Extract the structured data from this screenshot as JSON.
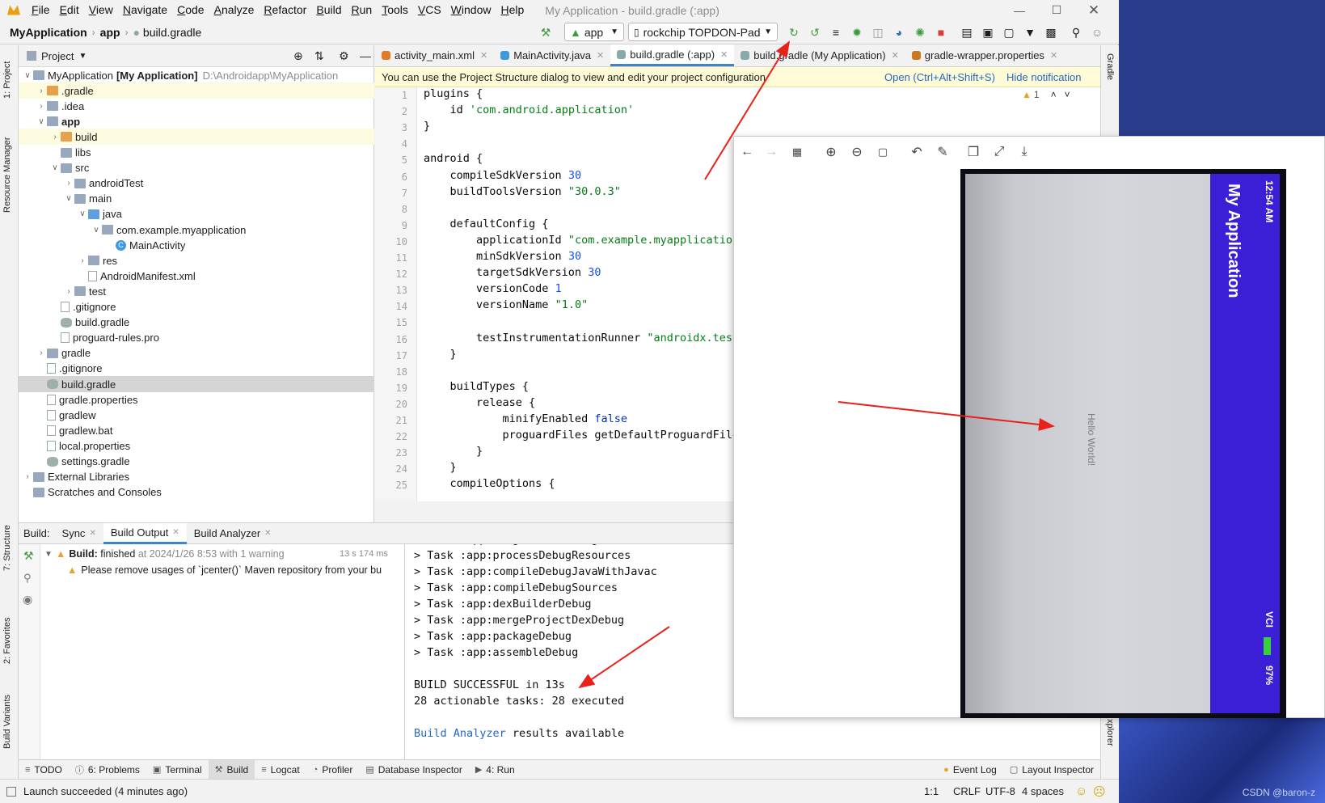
{
  "menubar": {
    "items": [
      {
        "label": "File",
        "mnemonic": "F",
        "rest": "ile"
      },
      {
        "label": "Edit",
        "mnemonic": "E",
        "rest": "dit"
      },
      {
        "label": "View",
        "mnemonic": "V",
        "rest": "iew"
      },
      {
        "label": "Navigate",
        "mnemonic": "N",
        "rest": "avigate"
      },
      {
        "label": "Code",
        "mnemonic": "C",
        "rest": "ode"
      },
      {
        "label": "Analyze",
        "mnemonic": "A",
        "rest": "nalyze"
      },
      {
        "label": "Refactor",
        "mnemonic": "R",
        "rest": "efactor"
      },
      {
        "label": "Build",
        "mnemonic": "B",
        "rest": "uild"
      },
      {
        "label": "Run",
        "mnemonic": "R",
        "rest": "un"
      },
      {
        "label": "Tools",
        "mnemonic": "T",
        "rest": "ools"
      },
      {
        "label": "VCS",
        "mnemonic": "V",
        "rest": "CS"
      },
      {
        "label": "Window",
        "mnemonic": "W",
        "rest": "indow"
      },
      {
        "label": "Help",
        "mnemonic": "H",
        "rest": "elp"
      }
    ],
    "window_title": "My Application - build.gradle (:app)"
  },
  "navbar": {
    "project": "MyApplication",
    "module": "app",
    "file": "build.gradle",
    "run_config": "app",
    "device": "rockchip TOPDON-Pad"
  },
  "left_strip": {
    "project": "1: Project",
    "resource_manager": "Resource Manager",
    "structure": "7: Structure",
    "favorites": "2: Favorites",
    "build_variants": "Build Variants"
  },
  "right_strip": {
    "gradle": "Gradle",
    "explorer": "xplorer"
  },
  "project_panel": {
    "title": "Project",
    "tree": [
      {
        "label": "MyApplication",
        "bold": "[My Application]",
        "extra": "D:\\Androidapp\\MyApplication"
      },
      {
        "label": ".gradle"
      },
      {
        "label": ".idea"
      },
      {
        "label": "app"
      },
      {
        "label": "build"
      },
      {
        "label": "libs"
      },
      {
        "label": "src"
      },
      {
        "label": "androidTest"
      },
      {
        "label": "main"
      },
      {
        "label": "java"
      },
      {
        "label": "com.example.myapplication"
      },
      {
        "label": "MainActivity"
      },
      {
        "label": "res"
      },
      {
        "label": "AndroidManifest.xml"
      },
      {
        "label": "test"
      },
      {
        "label": ".gitignore"
      },
      {
        "label": "build.gradle"
      },
      {
        "label": "proguard-rules.pro"
      },
      {
        "label": "gradle"
      },
      {
        "label": ".gitignore"
      },
      {
        "label": "build.gradle"
      },
      {
        "label": "gradle.properties"
      },
      {
        "label": "gradlew"
      },
      {
        "label": "gradlew.bat"
      },
      {
        "label": "local.properties"
      },
      {
        "label": "settings.gradle"
      },
      {
        "label": "External Libraries"
      },
      {
        "label": "Scratches and Consoles"
      }
    ]
  },
  "editor_tabs": [
    {
      "label": "activity_main.xml"
    },
    {
      "label": "MainActivity.java"
    },
    {
      "label": "build.gradle (:app)"
    },
    {
      "label": "build.gradle (My Application)"
    },
    {
      "label": "gradle-wrapper.properties"
    }
  ],
  "notification": {
    "text": "You can use the Project Structure dialog to view and edit your project configuration",
    "open_link": "Open (Ctrl+Alt+Shift+S)",
    "hide_link": "Hide notification",
    "warning_count": "1"
  },
  "code": {
    "line_numbers": [
      "1",
      "2",
      "3",
      "4",
      "5",
      "6",
      "7",
      "8",
      "9",
      "10",
      "11",
      "12",
      "13",
      "14",
      "15",
      "16",
      "17",
      "18",
      "19",
      "20",
      "21",
      "22",
      "23",
      "24",
      "25"
    ],
    "lines": [
      [
        "plugins {"
      ],
      [
        "    id ",
        "'com.android.application'"
      ],
      [
        "}"
      ],
      [
        ""
      ],
      [
        "android {"
      ],
      [
        "    compileSdkVersion ",
        "30"
      ],
      [
        "    buildToolsVersion ",
        "\"30.0.3\""
      ],
      [
        ""
      ],
      [
        "    defaultConfig {"
      ],
      [
        "        applicationId ",
        "\"com.example.myapplication\""
      ],
      [
        "        minSdkVersion ",
        "30"
      ],
      [
        "        targetSdkVersion ",
        "30"
      ],
      [
        "        versionCode ",
        "1"
      ],
      [
        "        versionName ",
        "\"1.0\""
      ],
      [
        ""
      ],
      [
        "        testInstrumentationRunner ",
        "\"androidx.test"
      ],
      [
        "    }"
      ],
      [
        ""
      ],
      [
        "    buildTypes {"
      ],
      [
        "        release {"
      ],
      [
        "            minifyEnabled ",
        "false"
      ],
      [
        "            proguardFiles getDefaultProguardFile"
      ],
      [
        "        }"
      ],
      [
        "    }"
      ],
      [
        "    compileOptions {"
      ]
    ]
  },
  "build_panel": {
    "label": "Build:",
    "tabs": [
      "Sync",
      "Build Output",
      "Build Analyzer"
    ],
    "status_bold": "Build:",
    "status": "finished",
    "status_detail": "at 2024/1/26 8:53 with 1 warning",
    "duration": "13 s 174 ms",
    "warning": "Please remove usages of `jcenter()` Maven repository from your bu",
    "output_lines": [
      "> Task :app:mergeExtDexDebug",
      "> Task :app:processDebugResources",
      "> Task :app:compileDebugJavaWithJavac",
      "> Task :app:compileDebugSources",
      "> Task :app:dexBuilderDebug",
      "> Task :app:mergeProjectDexDebug",
      "> Task :app:packageDebug",
      "> Task :app:assembleDebug",
      "",
      "BUILD SUCCESSFUL in 13s",
      "28 actionable tasks: 28 executed",
      ""
    ],
    "analyzer_link": "Build Analyzer",
    "analyzer_rest": " results available"
  },
  "bottom_tools": [
    {
      "label": "TODO",
      "icon": "list-icon"
    },
    {
      "label": "6: Problems",
      "icon": "problems-icon"
    },
    {
      "label": "Terminal",
      "icon": "terminal-icon"
    },
    {
      "label": "Build",
      "icon": "hammer-icon"
    },
    {
      "label": "Logcat",
      "icon": "logcat-icon"
    },
    {
      "label": "Profiler",
      "icon": "gauge-icon"
    },
    {
      "label": "Database Inspector",
      "icon": "database-icon"
    },
    {
      "label": "4: Run",
      "icon": "play-icon"
    },
    {
      "label": "Event Log",
      "icon": "event-log-icon"
    },
    {
      "label": "Layout Inspector",
      "icon": "layout-inspector-icon"
    }
  ],
  "status_bar": {
    "message": "Launch succeeded (4 minutes ago)",
    "position": "1:1",
    "line_sep": "CRLF",
    "encoding": "UTF-8",
    "indent": "4 spaces"
  },
  "viewer": {
    "app_title": "My Application",
    "time": "12:54 AM",
    "hello": "Hello World!",
    "carrier": "VCI",
    "battery": "97%"
  },
  "desktop": {
    "watermark": "CSDN @baron-z"
  },
  "colors": {
    "accent": "#4083c9",
    "app_bar": "#3a1fd6",
    "annotation_arrow": "#e8221b",
    "run_green": "#3f9b3f",
    "stop_red": "#db3b3b"
  }
}
